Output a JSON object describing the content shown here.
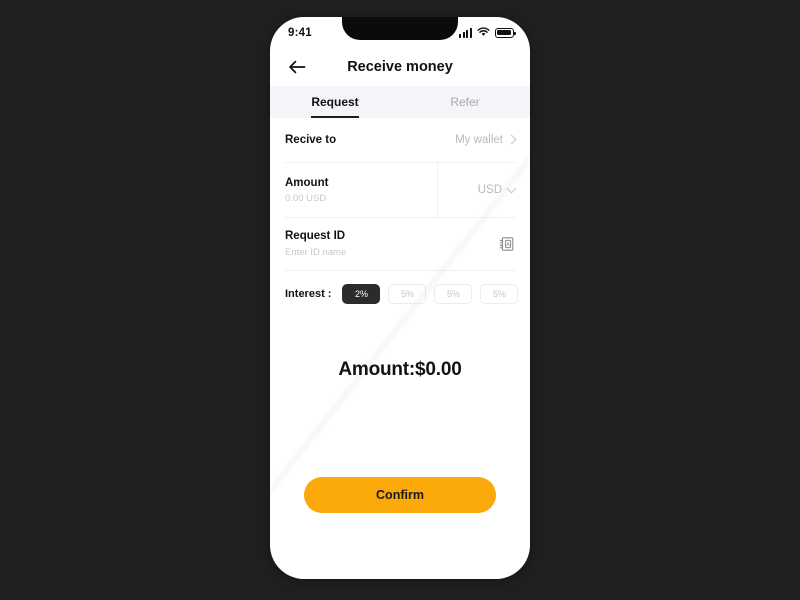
{
  "theme": {
    "canvas_bg": "#202020",
    "accent": "#faa80a",
    "chip_selected_bg": "#2b2b2b",
    "tab_bar_bg": "#f4f5f8",
    "text_primary": "#121212",
    "text_muted": "#b7b9bf"
  },
  "status_bar": {
    "time": "9:41",
    "signal_icon": "cellular-signal-icon",
    "wifi_icon": "wifi-icon",
    "battery_icon": "battery-icon"
  },
  "header": {
    "back_icon": "back-arrow-icon",
    "title": "Receive money"
  },
  "tabs": [
    {
      "label": "Request",
      "active": true
    },
    {
      "label": "Refer",
      "active": false
    }
  ],
  "form": {
    "receive_to": {
      "label": "Recive to",
      "value": "My wallet",
      "chevron_icon": "chevron-right-icon"
    },
    "amount": {
      "label": "Amount",
      "placeholder": "0.00 USD",
      "value": "",
      "currency": "USD",
      "chevron_icon": "chevron-down-icon"
    },
    "request_id": {
      "label": "Request ID",
      "placeholder": "Enter ID name",
      "value": "",
      "contact_icon": "contact-card-icon"
    }
  },
  "interest": {
    "label": "Interest :",
    "options": [
      {
        "label": "2%",
        "selected": true
      },
      {
        "label": "5%",
        "selected": false
      },
      {
        "label": "5%",
        "selected": false
      },
      {
        "label": "5%",
        "selected": false
      }
    ]
  },
  "summary": {
    "amount_text": "Amount:$0.00"
  },
  "footer": {
    "confirm_label": "Confirm"
  }
}
